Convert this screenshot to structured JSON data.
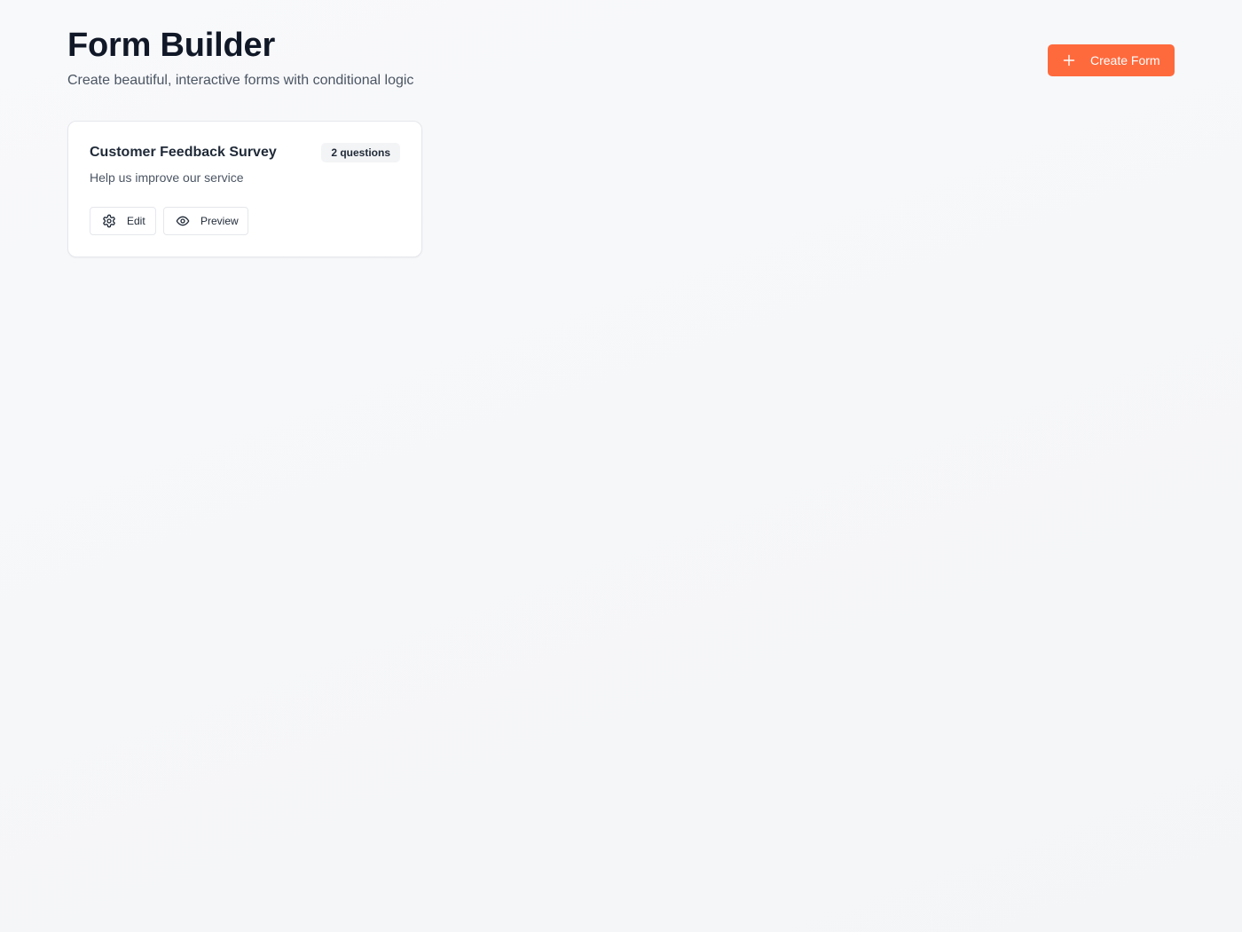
{
  "header": {
    "title": "Form Builder",
    "subtitle": "Create beautiful, interactive forms with conditional logic",
    "create_button": {
      "label": "Create Form",
      "icon": "plus-icon"
    }
  },
  "forms": [
    {
      "title": "Customer Feedback Survey",
      "badge": "2 questions",
      "description": "Help us improve our service",
      "actions": [
        {
          "label": "Edit",
          "icon": "gear-icon"
        },
        {
          "label": "Preview",
          "icon": "eye-icon"
        }
      ]
    }
  ],
  "colors": {
    "accent": "#ff6a3d",
    "text_primary": "#111827",
    "text_secondary": "#4b5563",
    "background": "#f6f7f9",
    "card_border": "#e5e7eb",
    "badge_background": "#f3f4f6"
  }
}
